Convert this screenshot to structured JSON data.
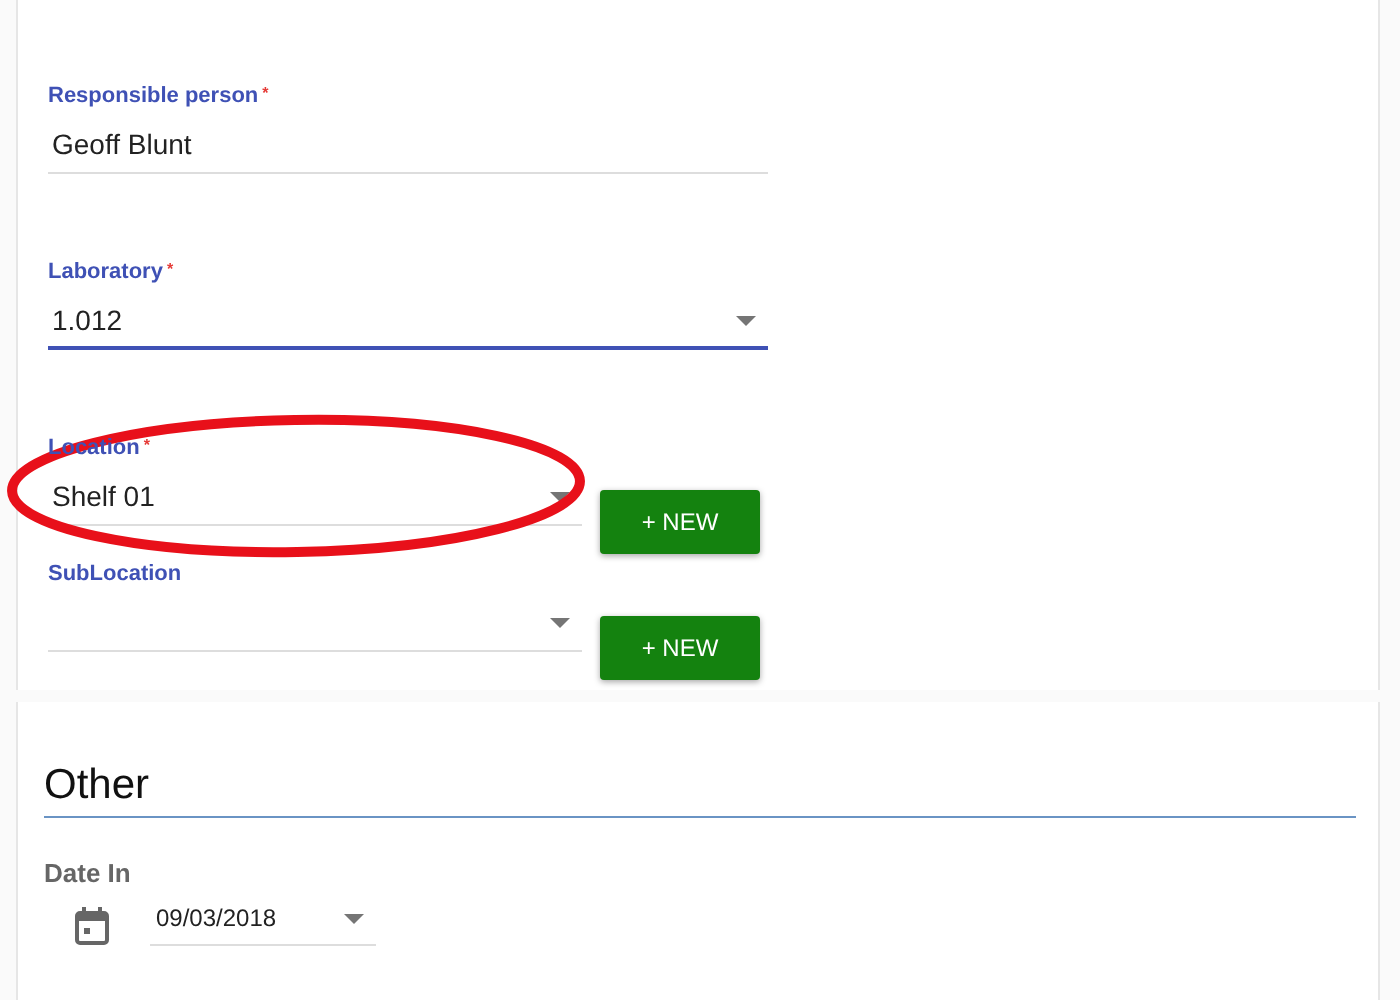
{
  "fields": [
    {
      "kind": "text",
      "label": "Responsible person",
      "required_mark": "*",
      "value": "Geoff Blunt",
      "focused": false
    },
    {
      "kind": "select",
      "label": "Laboratory",
      "required_mark": "*",
      "value": "1.012",
      "focused": true
    },
    {
      "kind": "select",
      "label": "Location",
      "required_mark": "*",
      "value": "Shelf 01",
      "focused": false,
      "button": "+ NEW",
      "annotated": true
    },
    {
      "kind": "select",
      "label": "SubLocation",
      "focused": false,
      "button": "+ NEW"
    }
  ],
  "section": {
    "title": "Other",
    "date": {
      "label": "Date In",
      "value": "09/03/2018"
    }
  }
}
